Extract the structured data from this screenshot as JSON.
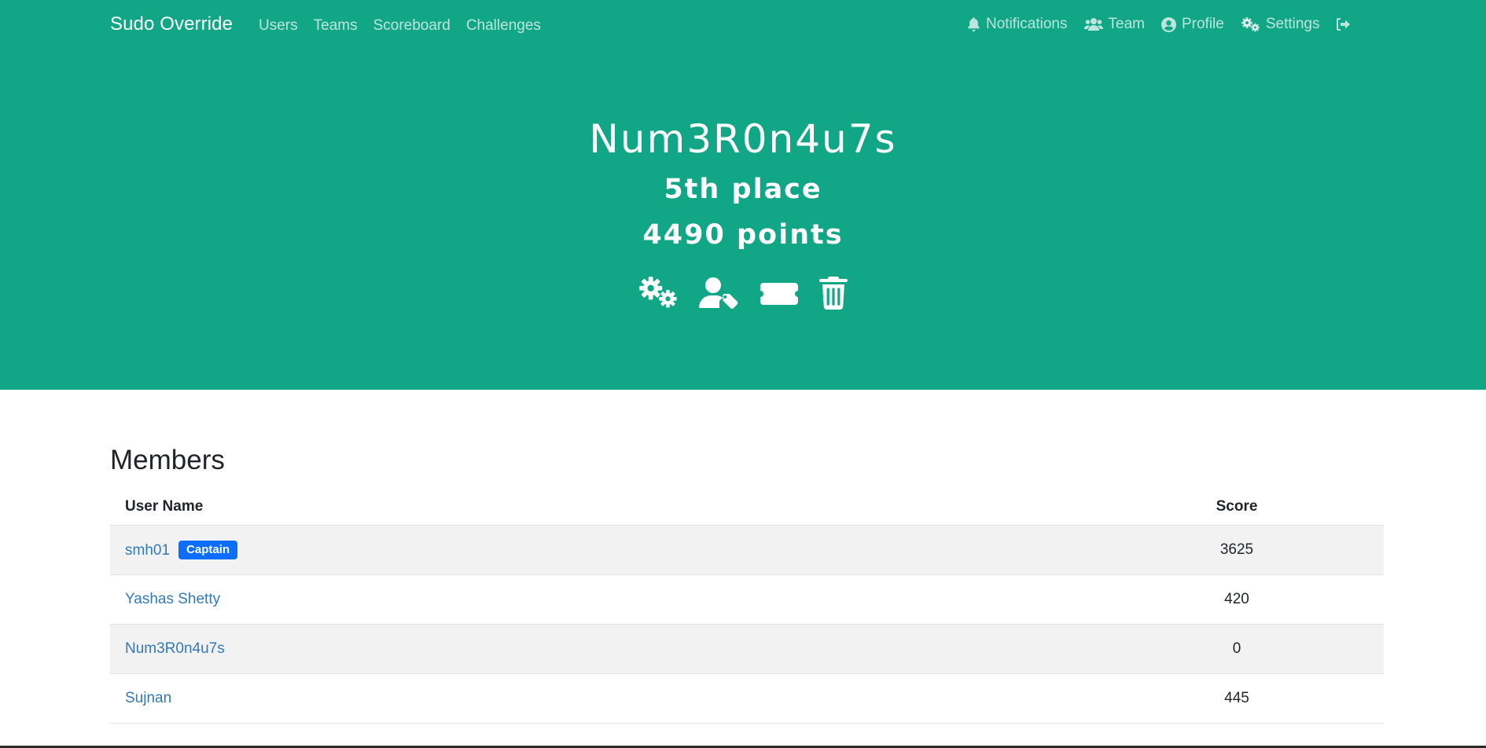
{
  "nav": {
    "brand": "Sudo Override",
    "left_links": [
      "Users",
      "Teams",
      "Scoreboard",
      "Challenges"
    ],
    "right_links": [
      {
        "label": "Notifications",
        "icon": "bell-icon"
      },
      {
        "label": "Team",
        "icon": "users-icon"
      },
      {
        "label": "Profile",
        "icon": "user-circle-icon"
      },
      {
        "label": "Settings",
        "icon": "gears-icon"
      }
    ],
    "logout_icon": "sign-out-icon"
  },
  "team": {
    "name": "Num3R0n4u7s",
    "place": "5th place",
    "points": "4490 points",
    "actions": [
      "gears-icon",
      "user-tag-icon",
      "ticket-icon",
      "trash-icon"
    ]
  },
  "members": {
    "title": "Members",
    "columns": [
      "User Name",
      "Score"
    ],
    "captain_badge": "Captain",
    "rows": [
      {
        "name": "smh01",
        "score": "3625",
        "captain": true
      },
      {
        "name": "Yashas Shetty",
        "score": "420",
        "captain": false
      },
      {
        "name": "Num3R0n4u7s",
        "score": "0",
        "captain": false
      },
      {
        "name": "Sujnan",
        "score": "445",
        "captain": false
      }
    ]
  },
  "colors": {
    "primary": "#10a686",
    "link": "#337ab7",
    "badge": "#0d6efd"
  }
}
